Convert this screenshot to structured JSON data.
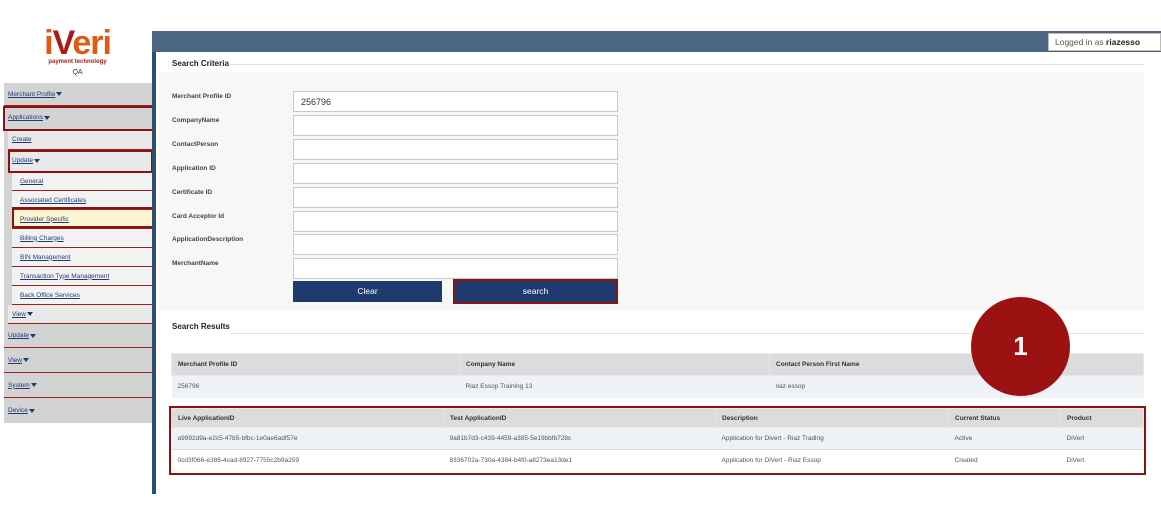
{
  "logo": {
    "brand_prefix": "i",
    "brand_v": "V",
    "brand_suffix": "eri",
    "tagline": "payment technology",
    "environment": "QA"
  },
  "header": {
    "logged_in_prefix": "Logged in as ",
    "username": "riazesso"
  },
  "sidebar": {
    "merchant_profile": "Merchant Profile",
    "applications": "Applications",
    "create": "Create",
    "update": "Update",
    "update_items": [
      "General",
      "Associated Certificates",
      "Provider Specific",
      "Billing Charges",
      "BIN Management",
      "Transaction Type Management",
      "Back Office Services"
    ],
    "view": "View",
    "top_update": "Update",
    "top_view": "View",
    "system": "System",
    "device": "Device"
  },
  "search_criteria": {
    "title": "Search Criteria",
    "fields": [
      {
        "label": "Merchant Profile ID",
        "value": "256796"
      },
      {
        "label": "CompanyName",
        "value": ""
      },
      {
        "label": "ContactPerson",
        "value": ""
      },
      {
        "label": "Application ID",
        "value": ""
      },
      {
        "label": "Certificate ID",
        "value": ""
      },
      {
        "label": "Card Acceptor Id",
        "value": ""
      },
      {
        "label": "ApplicationDescription",
        "value": ""
      },
      {
        "label": "MerchantName",
        "value": ""
      }
    ],
    "clear_label": "Clear",
    "search_label": "search"
  },
  "search_results": {
    "title": "Search Results",
    "merchant_table": {
      "headers": [
        "Merchant Profile ID",
        "Company Name",
        "Contact Person First Name"
      ],
      "rows": [
        [
          "256796",
          "Riaz Essop Training 13",
          "riaz essop"
        ]
      ]
    },
    "app_table": {
      "headers": [
        "Live ApplicationID",
        "Test ApplicationID",
        "Description",
        "Current Status",
        "Product"
      ],
      "rows": [
        [
          "a9992d9a-e2c5-47b5-bfbc-1e0ae6adf57e",
          "9a81b7d3-c439-4459-a385-5e19bbfb728c",
          "Application for Divert - Riaz Trading",
          "Active",
          "DiVert"
        ],
        [
          "0cd3f066-e386-4cad-8927-7755c2b9a259",
          "8336702a-730a-4384-b4f0-a8273ea13de1",
          "Application for DiVert - Riaz Essop",
          "Created",
          "DiVert"
        ]
      ]
    }
  },
  "callout": {
    "number": "1"
  },
  "colors": {
    "accent": "#9c1212",
    "topbar": "#4a6682",
    "button": "#1f3b6e",
    "sidebar": "#d3d3d3"
  }
}
